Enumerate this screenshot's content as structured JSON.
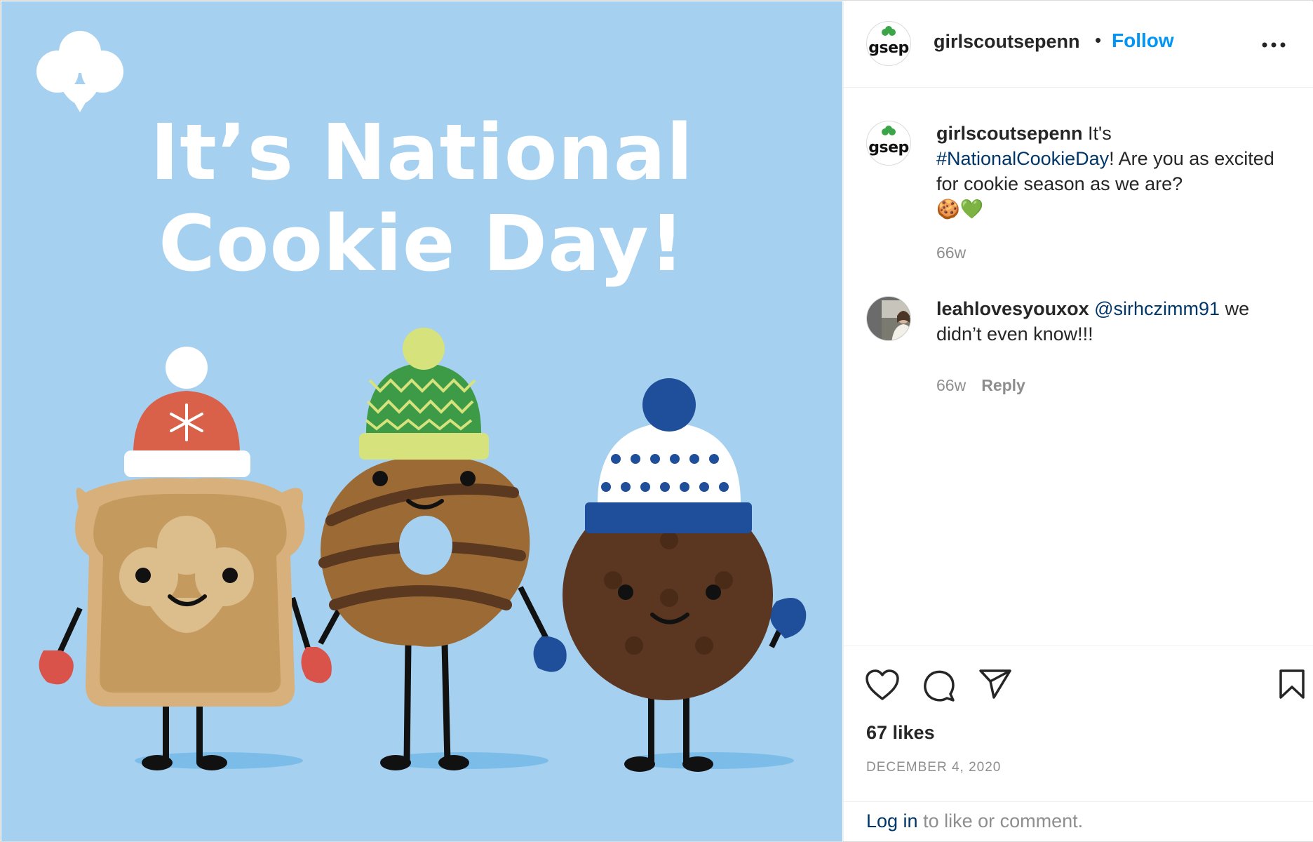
{
  "post_image": {
    "headline_line1": "It’s National",
    "headline_line2": "Cookie Day!"
  },
  "header": {
    "avatar_text": "gsep",
    "username": "girlscoutsepenn",
    "separator": "•",
    "follow_label": "Follow"
  },
  "comments": [
    {
      "avatar_text": "gsep",
      "username": "girlscoutsepenn",
      "text_before": " It's ",
      "hashtag": "#NationalCookieDay",
      "text_after": "! Are you as excited for cookie season as we are?",
      "emojis": "🍪💚",
      "age": "66w"
    },
    {
      "username": "leahlovesyouxox",
      "mention": "@sirhczimm91",
      "text_after": " we didn’t even know!!!",
      "age": "66w",
      "reply_label": "Reply"
    }
  ],
  "actions": {
    "likes": "67 likes",
    "date": "DECEMBER 4, 2020"
  },
  "login": {
    "link_label": "Log in",
    "rest": " to like or comment."
  },
  "colors": {
    "image_bg": "#a5d0ef",
    "follow_blue": "#0095f6",
    "link_dark_blue": "#00376b",
    "muted_gray": "#8e8e8e"
  },
  "icons": [
    "trefoil-logo-icon",
    "more-options-icon",
    "heart-icon",
    "comment-icon",
    "share-icon",
    "bookmark-icon"
  ]
}
